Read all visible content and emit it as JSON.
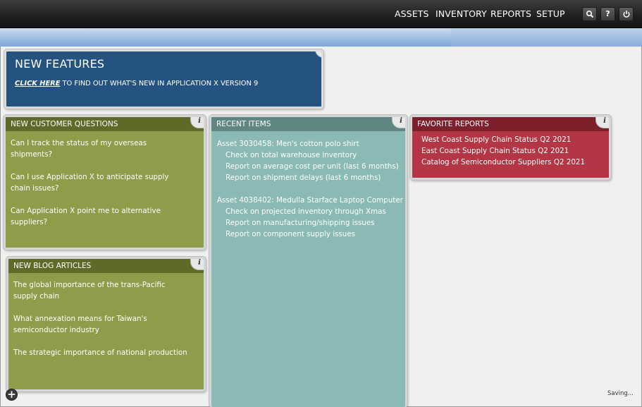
{
  "nav": {
    "assets": "ASSETS",
    "inventory": "INVENTORY",
    "reports": "REPORTS",
    "setup": "SETUP"
  },
  "toolbar": {
    "search_icon": "search-icon",
    "help_label": "?",
    "power_icon": "power-icon"
  },
  "features": {
    "title": "NEW FEATURES",
    "link_label": "CLICK HERE",
    "link_suffix": " TO FIND OUT WHAT'S NEW IN APPLICATION X VERSION 9"
  },
  "questions": {
    "title": "NEW CUSTOMER QUESTIONS",
    "items": [
      "Can I track the status of my overseas shipments?",
      "Can I use Application X to anticipate supply chain issues?",
      "Can Application X point me to alternative suppliers?"
    ]
  },
  "blogs": {
    "title": "NEW BLOG ARTICLES",
    "items": [
      "The global importance of the trans-Pacific supply chain",
      "What annexation means for Taiwan's semiconductor industry",
      "The strategic importance of national production"
    ]
  },
  "recent": {
    "title": "RECENT ITEMS",
    "groups": [
      {
        "asset": "Asset 3030458: Men's cotton polo shirt",
        "items": [
          "Check on total warehouse inventory",
          "Report on average cost per unit (last 6 months)",
          "Report on shipment delays (last 6 months)"
        ]
      },
      {
        "asset": "Asset 4038402: Medulla Starface Laptop Computer",
        "items": [
          "Check on projected inventory through Xmas",
          "Report on manufacturing/shipping issues",
          "Report on component supply issues"
        ]
      }
    ]
  },
  "favorites": {
    "title": "FAVORITE REPORTS",
    "items": [
      "West Coast Supply Chain Status Q2 2021",
      "East Coast Supply Chain Status Q2 2021",
      "Catalog of Semiconductor Suppliers Q2 2021"
    ]
  },
  "info_label": "i",
  "add_label": "+",
  "status": "Saving..."
}
